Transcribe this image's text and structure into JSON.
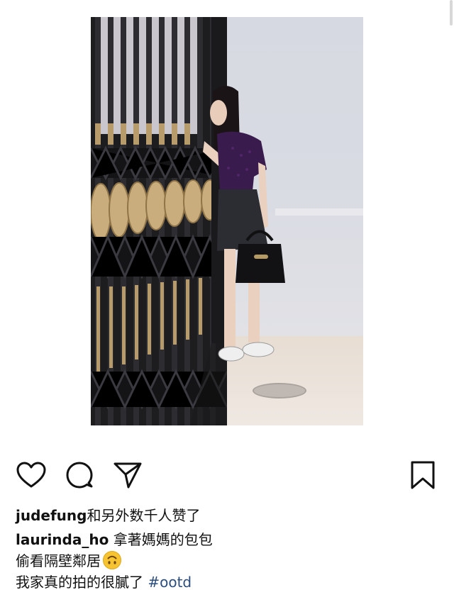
{
  "post": {
    "likes": {
      "username": "judefung",
      "suffix": "和另外数千人赞了"
    },
    "caption": {
      "username": "laurinda_ho",
      "line1": "拿著媽媽的包包",
      "line2": "偷看隔壁鄰居",
      "line2_emoji": "upside-down-face-emoji",
      "line3": "我家真的拍的很膩了",
      "hashtag": "#ootd"
    }
  },
  "actions": {
    "like_icon": "heart-icon",
    "comment_icon": "comment-icon",
    "share_icon": "send-icon",
    "save_icon": "bookmark-icon"
  },
  "colors": {
    "hashtag": "#2b4d7e",
    "text": "#111111",
    "background": "#ffffff"
  }
}
